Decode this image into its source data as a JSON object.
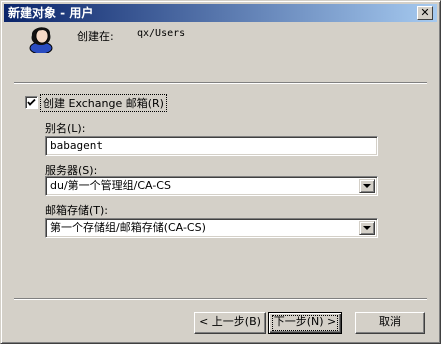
{
  "window": {
    "title": "新建对象 - 用户",
    "close_symbol": "✕"
  },
  "header": {
    "created_in_label": "创建在:",
    "created_in_path": "qx/Users",
    "avatar_icon": "user-icon"
  },
  "exchange": {
    "create_mailbox_label": "创建 Exchange 邮箱(R)",
    "checked": true,
    "alias_label": "别名(L):",
    "alias_value": "babagent",
    "server_label": "服务器(S):",
    "server_value": "du/第一个管理组/CA-CS",
    "store_label": "邮箱存储(T):",
    "store_value": "第一个存储组/邮箱存储(CA-CS)"
  },
  "buttons": {
    "back": "< 上一步(B)",
    "next": "下一步(N) >",
    "cancel": "取消"
  }
}
